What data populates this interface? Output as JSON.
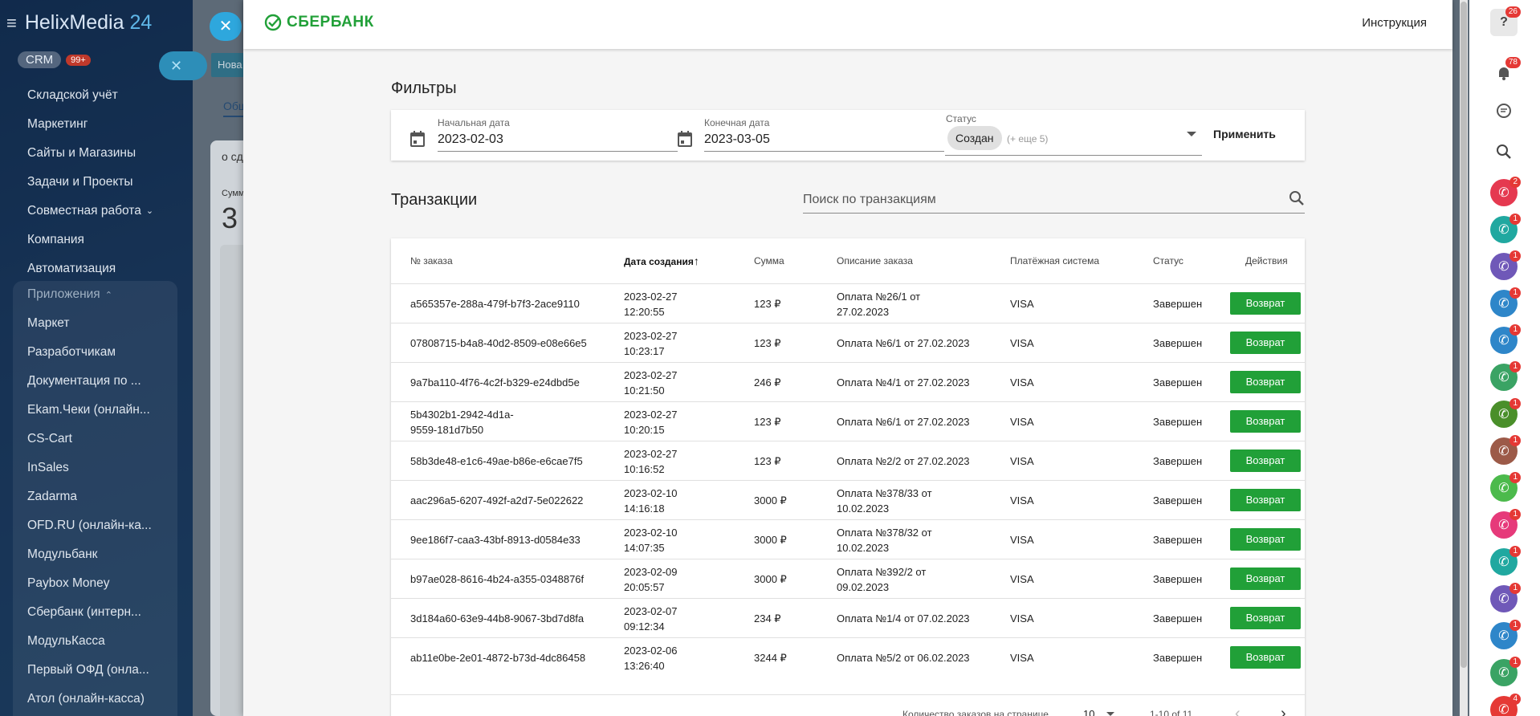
{
  "sidebar": {
    "brand_name": "HelixMedia",
    "brand_num": "24",
    "crm_label": "CRM",
    "crm_badge": "99+",
    "items": [
      "Складской учёт",
      "Маркетинг",
      "Сайты и Магазины",
      "Задачи и Проекты",
      "Совместная работа",
      "Компания",
      "Автоматизация"
    ],
    "apps_header": "Приложения",
    "apps": [
      "Маркет",
      "Разработчикам",
      "Документация по ...",
      "Ekam.Чеки (онлайн...",
      "CS-Cart",
      "InSales",
      "Zadarma",
      "OFD.RU (онлайн-ка...",
      "Модульбанк",
      "Paybox Money",
      "Сбербанк (интерн...",
      "МодульКасса",
      "Первый ОФД (онла...",
      "Атол (онлайн-касса)"
    ]
  },
  "background": {
    "new_label": "Нова",
    "tab_label": "Общ",
    "card_title": "о сд",
    "card_sub": "Сумм",
    "card_big": "3"
  },
  "header": {
    "logo_text": "СБЕРБАНК",
    "instructions_link": "Инструкция"
  },
  "filters": {
    "title": "Фильтры",
    "start_label": "Начальная дата",
    "start_value": "2023-02-03",
    "end_label": "Конечная дата",
    "end_value": "2023-03-05",
    "status_label": "Статус",
    "status_chip": "Создан",
    "status_more": "(+ еще 5)",
    "apply_label": "Применить"
  },
  "transactions": {
    "title": "Транзакции",
    "search_placeholder": "Поиск по транзакциям",
    "columns": [
      "№ заказа",
      "Дата создания",
      "Сумма",
      "Описание заказа",
      "Платёжная система",
      "Статус",
      "Действия"
    ],
    "sort_arrow": "↑",
    "rows": [
      {
        "id": "a565357e-288a-479f-b7f3-2ace9110",
        "date": "2023-02-27",
        "time": "12:20:55",
        "sum": "123 ₽",
        "desc1": "Оплата №26/1 от",
        "desc2": "27.02.2023",
        "ps": "VISA",
        "status": "Завершен",
        "action": "Возврат"
      },
      {
        "id": "07808715-b4a8-40d2-8509-e08e66e5",
        "date": "2023-02-27",
        "time": "10:23:17",
        "sum": "123 ₽",
        "desc1": "Оплата №6/1 от 27.02.2023",
        "desc2": "",
        "ps": "VISA",
        "status": "Завершен",
        "action": "Возврат"
      },
      {
        "id": "9a7ba110-4f76-4c2f-b329-e24dbd5e",
        "date": "2023-02-27",
        "time": "10:21:50",
        "sum": "246 ₽",
        "desc1": "Оплата №4/1 от 27.02.2023",
        "desc2": "",
        "ps": "VISA",
        "status": "Завершен",
        "action": "Возврат"
      },
      {
        "id": "5b4302b1-2942-4d1a-",
        "id2": "9559-181d7b50",
        "date": "2023-02-27",
        "time": "10:20:15",
        "sum": "123 ₽",
        "desc1": "Оплата №6/1 от 27.02.2023",
        "desc2": "",
        "ps": "VISA",
        "status": "Завершен",
        "action": "Возврат"
      },
      {
        "id": "58b3de48-e1c6-49ae-b86e-e6cae7f5",
        "date": "2023-02-27",
        "time": "10:16:52",
        "sum": "123 ₽",
        "desc1": "Оплата №2/2 от 27.02.2023",
        "desc2": "",
        "ps": "VISA",
        "status": "Завершен",
        "action": "Возврат"
      },
      {
        "id": "aac296a5-6207-492f-a2d7-5e022622",
        "date": "2023-02-10",
        "time": "14:16:18",
        "sum": "3000 ₽",
        "desc1": "Оплата №378/33 от",
        "desc2": "10.02.2023",
        "ps": "VISA",
        "status": "Завершен",
        "action": "Возврат"
      },
      {
        "id": "9ee186f7-caa3-43bf-8913-d0584e33",
        "date": "2023-02-10",
        "time": "14:07:35",
        "sum": "3000 ₽",
        "desc1": "Оплата №378/32 от",
        "desc2": "10.02.2023",
        "ps": "VISA",
        "status": "Завершен",
        "action": "Возврат"
      },
      {
        "id": "b97ae028-8616-4b24-a355-0348876f",
        "date": "2023-02-09",
        "time": "20:05:57",
        "sum": "3000 ₽",
        "desc1": "Оплата №392/2 от",
        "desc2": "09.02.2023",
        "ps": "VISA",
        "status": "Завершен",
        "action": "Возврат"
      },
      {
        "id": "3d184a60-63e9-44b8-9067-3bd7d8fa",
        "date": "2023-02-07",
        "time": "09:12:34",
        "sum": "234 ₽",
        "desc1": "Оплата №1/4 от 07.02.2023",
        "desc2": "",
        "ps": "VISA",
        "status": "Завершен",
        "action": "Возврат"
      },
      {
        "id": "ab11e0be-2e01-4872-b73d-4dc86458",
        "date": "2023-02-06",
        "time": "13:26:40",
        "sum": "3244 ₽",
        "desc1": "Оплата №5/2 от 06.02.2023",
        "desc2": "",
        "ps": "VISA",
        "status": "Завершен",
        "action": "Возврат"
      }
    ],
    "pagination": {
      "per_page_label": "Количество заказов на странице",
      "per_page": "10",
      "range": "1-10 of 11"
    }
  },
  "rightbar": {
    "help_badge": "26",
    "notif_badge": "78",
    "contacts": [
      {
        "color": "#e53950",
        "badge": "2"
      },
      {
        "color": "#20a8a0",
        "badge": "1"
      },
      {
        "color": "#6f58b8",
        "badge": "1"
      },
      {
        "color": "#2e86c9",
        "badge": "1"
      },
      {
        "color": "#2e86c9",
        "badge": "1"
      },
      {
        "color": "#3aa364",
        "badge": "1"
      },
      {
        "color": "#4a8f2a",
        "badge": "1"
      },
      {
        "color": "#9c5a48",
        "badge": "1"
      },
      {
        "color": "#4cba4c",
        "badge": "1"
      },
      {
        "color": "#e63a7a",
        "badge": "1"
      },
      {
        "color": "#20a8a0",
        "badge": "1"
      },
      {
        "color": "#6f58b8",
        "badge": "1"
      },
      {
        "color": "#2e86c9",
        "badge": "1"
      },
      {
        "color": "#3aa364",
        "badge": "1"
      },
      {
        "color": "#e53935",
        "badge": "4"
      }
    ]
  },
  "colors": {
    "accent": "#21a038",
    "sidebar": "#2a5c9a"
  }
}
